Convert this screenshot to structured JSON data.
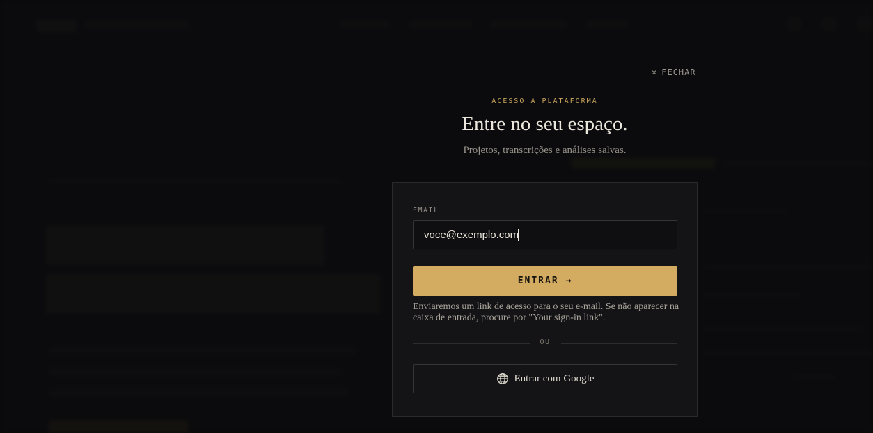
{
  "modal": {
    "close_label": "FECHAR",
    "close_icon": "×",
    "eyebrow": "ACESSO À PLATAFORMA",
    "title": "Entre no seu espaço.",
    "subtitle": "Projetos, transcrições e análises salvas.",
    "form": {
      "email_label": "EMAIL",
      "email_value": "voce@exemplo.com",
      "submit_label": "ENTRAR →",
      "help_text": "Enviaremos um link de acesso para o seu e-mail. Se não aparecer na caixa de entrada, procure por \"Your sign-in link\".",
      "divider_label": "OU",
      "google_label": "Entrar com Google",
      "google_icon": "globe-icon"
    }
  },
  "colors": {
    "accent": "#d3ab61",
    "eyebrow": "#c9a45c",
    "background": "#0c0c0e",
    "card": "#141417"
  }
}
